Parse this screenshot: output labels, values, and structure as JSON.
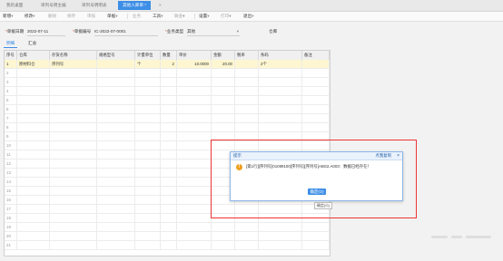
{
  "tabs": [
    {
      "label": "我的桌面",
      "active": false
    },
    {
      "label": "单列号明主编",
      "active": false
    },
    {
      "label": "单列号明明表",
      "active": false
    },
    {
      "label": "其他入库单 *",
      "active": true
    },
    {
      "label": "×",
      "active": false
    }
  ],
  "toolbar": [
    {
      "label": "新增",
      "chevron": true
    },
    {
      "label": "修改",
      "chevron": true
    },
    {
      "label": "删除",
      "chevron": false
    },
    {
      "label": "保存",
      "chevron": false
    },
    {
      "label": "审核",
      "chevron": false
    },
    {
      "label": "单据",
      "chevron": true
    },
    {
      "label": "业务",
      "chevron": false
    },
    {
      "label": "工具",
      "chevron": true
    },
    {
      "label": "联查",
      "chevron": true
    },
    {
      "label": "设置",
      "chevron": true
    },
    {
      "label": "打印",
      "chevron": true
    },
    {
      "label": "退出",
      "chevron": true
    }
  ],
  "form": {
    "date_label": "单据日期",
    "date_value": "2022-07-11",
    "number_label": "单据编号",
    "number_value": "IC-2022-07-0001",
    "biztype_label": "业务类型",
    "biztype_value": "其他",
    "warehouse_label": "仓库"
  },
  "inner_tabs": [
    {
      "label": "明细",
      "active": true
    },
    {
      "label": "汇总",
      "active": false
    }
  ],
  "grid": {
    "columns": [
      "序号",
      "仓库",
      "存货名称",
      "规格型号",
      "计量单位",
      "数量",
      "单价",
      "金额",
      "税率",
      "条码",
      "备注"
    ],
    "rows": [
      {
        "no": "1",
        "warehouse": "原材料仓",
        "item": "序列号",
        "spec": "",
        "unit": "个",
        "qty": "2",
        "price": "10.0000",
        "amount": "20.00",
        "tax": "",
        "code": "2个",
        "memo": ""
      }
    ],
    "empty_rows": [
      "2",
      "3",
      "4",
      "5",
      "6",
      "7",
      "8",
      "9",
      "10",
      "11",
      "12",
      "13",
      "14",
      "15",
      "16",
      "17",
      "18",
      "19",
      "20",
      "21"
    ]
  },
  "dialog": {
    "title": "提示",
    "copy_label": "点我复制",
    "close": "×",
    "message": "[第1行][序列号]01089100[序列号][序列号]ABS2.A003：数据已经存在！",
    "ok_label": "确定(O)"
  },
  "tooltip": "确定(O)"
}
